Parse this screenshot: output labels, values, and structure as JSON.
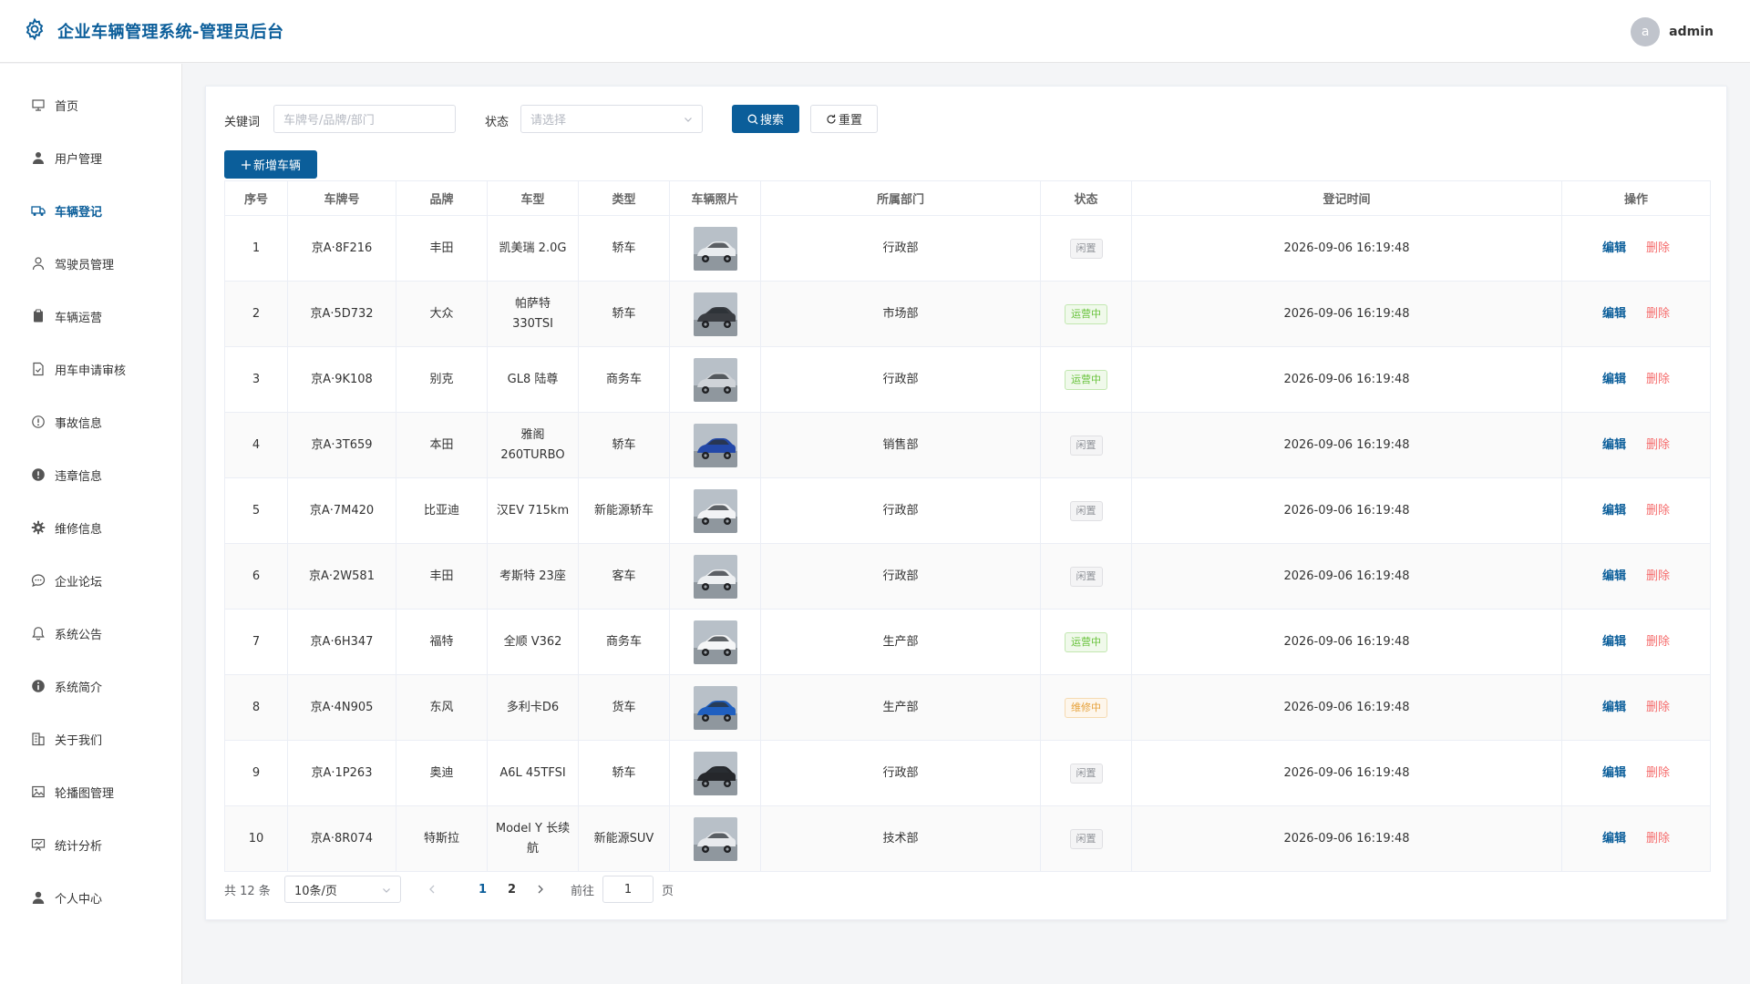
{
  "header": {
    "title": "企业车辆管理系统-管理员后台",
    "avatar_letter": "a",
    "username": "admin"
  },
  "sidebar": {
    "items": [
      {
        "label": "首页",
        "icon": "monitor-icon"
      },
      {
        "label": "用户管理",
        "icon": "user-icon"
      },
      {
        "label": "车辆登记",
        "icon": "truck-icon",
        "active": true
      },
      {
        "label": "驾驶员管理",
        "icon": "user-outline-icon"
      },
      {
        "label": "车辆运营",
        "icon": "clipboard-icon"
      },
      {
        "label": "用车申请审核",
        "icon": "document-check-icon"
      },
      {
        "label": "事故信息",
        "icon": "warning-circle-icon"
      },
      {
        "label": "违章信息",
        "icon": "warning-filled-icon"
      },
      {
        "label": "维修信息",
        "icon": "gear-icon"
      },
      {
        "label": "企业论坛",
        "icon": "chat-icon"
      },
      {
        "label": "系统公告",
        "icon": "bell-icon"
      },
      {
        "label": "系统简介",
        "icon": "info-icon"
      },
      {
        "label": "关于我们",
        "icon": "office-building-icon"
      },
      {
        "label": "轮播图管理",
        "icon": "picture-icon"
      },
      {
        "label": "统计分析",
        "icon": "data-board-icon"
      },
      {
        "label": "个人中心",
        "icon": "avatar-icon"
      }
    ]
  },
  "filters": {
    "keyword_label": "关键词",
    "keyword_placeholder": "车牌号/品牌/部门",
    "status_label": "状态",
    "status_placeholder": "请选择",
    "search_button": "搜索",
    "reset_button": "重置",
    "add_button": "新增车辆"
  },
  "table": {
    "headers": [
      "序号",
      "车牌号",
      "品牌",
      "车型",
      "类型",
      "车辆照片",
      "所属部门",
      "状态",
      "登记时间",
      "操作"
    ],
    "edit_label": "编辑",
    "delete_label": "删除",
    "rows": [
      {
        "index": "1",
        "plate": "京A·8F216",
        "brand": "丰田",
        "model": "凯美瑞 2.0G",
        "type": "轿车",
        "dept": "行政部",
        "status": "闲置",
        "status_kind": "idle",
        "time": "2026-09-06 16:19:48",
        "photo_color": "#e9ecef"
      },
      {
        "index": "2",
        "plate": "京A·5D732",
        "brand": "大众",
        "model": "帕萨特 330TSI",
        "type": "轿车",
        "dept": "市场部",
        "status": "运营中",
        "status_kind": "run",
        "time": "2026-09-06 16:19:48",
        "photo_color": "#3a3d42"
      },
      {
        "index": "3",
        "plate": "京A·9K108",
        "brand": "别克",
        "model": "GL8 陆尊",
        "type": "商务车",
        "dept": "行政部",
        "status": "运营中",
        "status_kind": "run",
        "time": "2026-09-06 16:19:48",
        "photo_color": "#cfd3d8"
      },
      {
        "index": "4",
        "plate": "京A·3T659",
        "brand": "本田",
        "model": "雅阁 260TURBO",
        "type": "轿车",
        "dept": "销售部",
        "status": "闲置",
        "status_kind": "idle",
        "time": "2026-09-06 16:19:48",
        "photo_color": "#2348a8"
      },
      {
        "index": "5",
        "plate": "京A·7M420",
        "brand": "比亚迪",
        "model": "汉EV 715km",
        "type": "新能源轿车",
        "dept": "行政部",
        "status": "闲置",
        "status_kind": "idle",
        "time": "2026-09-06 16:19:48",
        "photo_color": "#f2f3f5"
      },
      {
        "index": "6",
        "plate": "京A·2W581",
        "brand": "丰田",
        "model": "考斯特 23座",
        "type": "客车",
        "dept": "行政部",
        "status": "闲置",
        "status_kind": "idle",
        "time": "2026-09-06 16:19:48",
        "photo_color": "#eef0f2"
      },
      {
        "index": "7",
        "plate": "京A·6H347",
        "brand": "福特",
        "model": "全顺 V362",
        "type": "商务车",
        "dept": "生产部",
        "status": "运营中",
        "status_kind": "run",
        "time": "2026-09-06 16:19:48",
        "photo_color": "#f5f6f7"
      },
      {
        "index": "8",
        "plate": "京A·4N905",
        "brand": "东风",
        "model": "多利卡D6",
        "type": "货车",
        "dept": "生产部",
        "status": "维修中",
        "status_kind": "fix",
        "time": "2026-09-06 16:19:48",
        "photo_color": "#1f5fc0"
      },
      {
        "index": "9",
        "plate": "京A·1P263",
        "brand": "奥迪",
        "model": "A6L 45TFSI",
        "type": "轿车",
        "dept": "行政部",
        "status": "闲置",
        "status_kind": "idle",
        "time": "2026-09-06 16:19:48",
        "photo_color": "#25272b"
      },
      {
        "index": "10",
        "plate": "京A·8R074",
        "brand": "特斯拉",
        "model": "Model Y 长续航",
        "type": "新能源SUV",
        "dept": "技术部",
        "status": "闲置",
        "status_kind": "idle",
        "time": "2026-09-06 16:19:48",
        "photo_color": "#e8eaed"
      }
    ]
  },
  "pagination": {
    "total_text": "共 12 条",
    "page_size": "10条/页",
    "pages": [
      "1",
      "2"
    ],
    "current_page": "1",
    "goto_label": "前往",
    "goto_value": "1",
    "page_suffix": "页"
  }
}
